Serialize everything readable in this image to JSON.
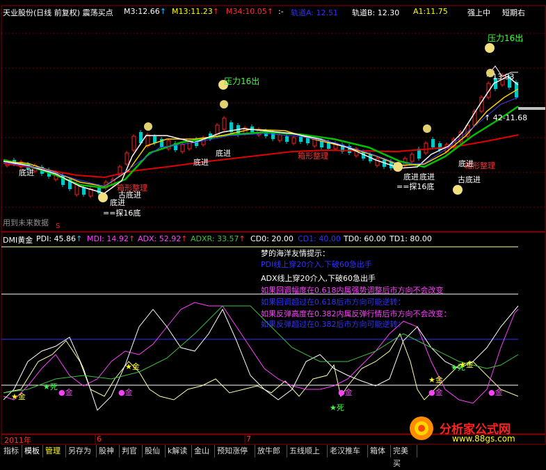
{
  "colors": {
    "background": "#000000",
    "frame": "#8b0000",
    "price_up": "#ff2020",
    "price_down": "#00c8c8",
    "ma_white": "#ffffff",
    "ma_yellow": "#ffd000",
    "ma_green": "#00c000",
    "ma_red": "#e00000",
    "pdi": "#ffffff",
    "mdi": "#ff40ff",
    "adx": "#c0c000",
    "adxr": "#40c040",
    "td0": "#ffffff",
    "td1": "#ffffff",
    "cd1": "#3030ff"
  },
  "header": {
    "title": "天业股份(日线 前复权) 震荡买点",
    "m3_label": "M3:",
    "m3_value": "12.66",
    "m13_label": "M13:",
    "m13_value": "11.23",
    "m34_label": "M34:",
    "m34_value": "10.05",
    "sep": ":-",
    "track_a_label": "轨道A:",
    "track_a_value": "12.51",
    "track_b_label": "轨道B:",
    "track_b_value": "12.30",
    "a1_label": "A1:",
    "a1_value": "11.75",
    "strong": "强上中",
    "short_term": "短期右"
  },
  "price_labels": {
    "press1": "压力16出",
    "press2": "压力16出",
    "value_1393": "13.93",
    "range": "↑ 42-11.68",
    "no_future": "用到未来数据",
    "dollar": "$",
    "s_mark": "S",
    "rect_a": "箱形整理",
    "rect_b": "箱形整理",
    "rect_c": "箱形整理",
    "dijin": [
      "底进",
      "底进",
      "底进",
      "底进",
      "底进",
      "底进",
      "底进"
    ],
    "gu_dijin_1": "古底进",
    "gu_dijin_2": "古底进",
    "tan_1": "==探16底",
    "tan_2": "==探16底",
    "arrow_up": "↑"
  },
  "indicator": {
    "name": "DMI黄金",
    "pdi_label": "PDI:",
    "pdi_value": "45.86",
    "mdi_label": "MDI:",
    "mdi_value": "14.92",
    "adx_label": "ADX:",
    "adx_value": "52.92",
    "adxr_label": "ADXR:",
    "adxr_value": "33.57",
    "cd0_label": "CD0:",
    "cd0_value": "20.00",
    "cd1_label": "CD1:",
    "cd1_value": "40.00",
    "td0_label": "TD0:",
    "td0_value": "60.00",
    "td1_label": "TD1:",
    "td1_value": "80.00",
    "tips": [
      "梦的海洋友情提示：",
      "PDI线上穿20介入,下破60急出手",
      "ADX线上穿20介入,下破60急出手",
      "如果回调幅度在0.618内属强势调整后市方向不会改变",
      "如果回调超过在0.618后市方向可能逆转：",
      "如果反弹高度在0.382内属反弹行情后市方向不会改变：",
      "如果反弹超过在0.382后市方向可能逆转："
    ],
    "gold": "金",
    "death": "死",
    "marks": [
      "★金",
      "★死",
      "●金",
      "★金",
      "●金",
      "★死",
      "●金",
      "★金",
      "●金",
      "★死",
      "★金",
      "●金"
    ]
  },
  "timeline": {
    "year": "2011年",
    "months": [
      "6",
      "7"
    ]
  },
  "tabs": [
    "指标",
    "模板",
    "管理",
    "另存为",
    "股神",
    "判官",
    "股仙",
    "k解读",
    "金山",
    "预知涨停",
    "放牛郎",
    "五线顺上",
    "老汉推车",
    "箱体",
    "完美买"
  ],
  "watermark": {
    "brand": "分析家公式网",
    "url": "www.88gs.com"
  }
}
